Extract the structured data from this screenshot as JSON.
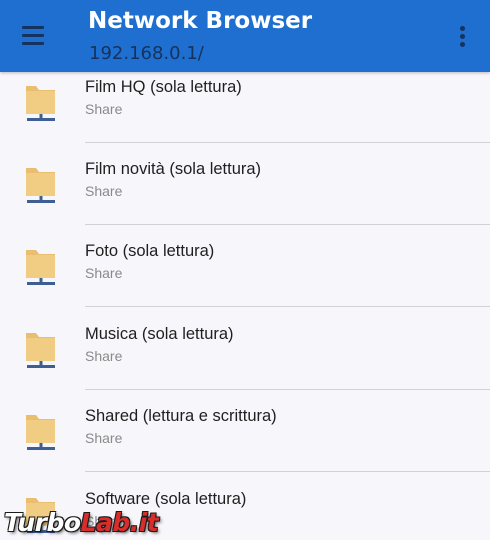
{
  "app": {
    "title": "Network Browser",
    "subtitle": "192.168.0.1/",
    "menu_icon": "hamburger-menu-icon",
    "overflow_icon": "more-vert-icon",
    "accent_color": "#1e6fd0"
  },
  "shares": [
    {
      "name": "Film HQ (sola lettura)",
      "type": "Share",
      "icon": "network-folder-icon"
    },
    {
      "name": "Film novità (sola lettura)",
      "type": "Share",
      "icon": "network-folder-icon"
    },
    {
      "name": "Foto (sola lettura)",
      "type": "Share",
      "icon": "network-folder-icon"
    },
    {
      "name": "Musica (sola lettura)",
      "type": "Share",
      "icon": "network-folder-icon"
    },
    {
      "name": "Shared (lettura e scrittura)",
      "type": "Share",
      "icon": "network-folder-icon"
    },
    {
      "name": "Software (sola lettura)",
      "type": "Share",
      "icon": "network-folder-icon"
    }
  ],
  "watermark": {
    "prefix": "Turbo",
    "suffix": "Lab.it"
  }
}
